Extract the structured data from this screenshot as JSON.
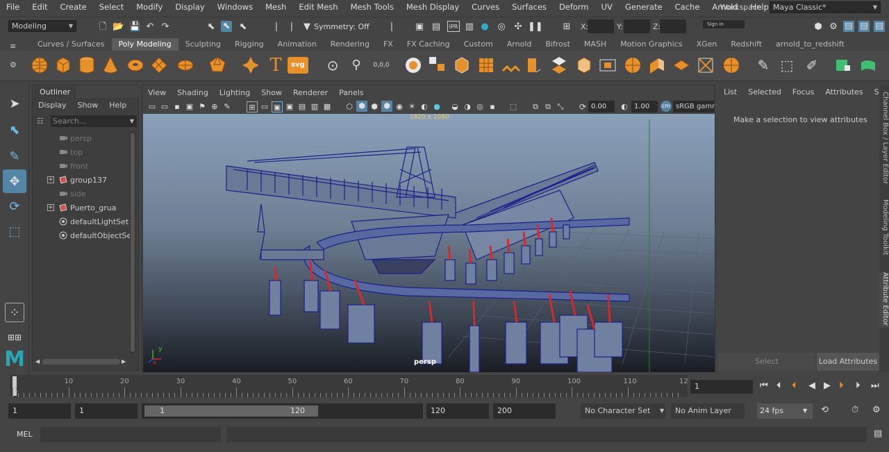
{
  "menubar": {
    "items": [
      "File",
      "Edit",
      "Create",
      "Select",
      "Modify",
      "Display",
      "Windows",
      "Mesh",
      "Edit Mesh",
      "Mesh Tools",
      "Mesh Display",
      "Curves",
      "Surfaces",
      "Deform",
      "UV",
      "Generate",
      "Cache",
      "Arnold",
      "Help"
    ],
    "workspace_label": "Workspace :",
    "workspace_value": "Maya Classic*"
  },
  "statusline": {
    "menuset": "Modeling",
    "symmetry": "Symmetry: Off",
    "x_label": "X:",
    "y_label": "Y:",
    "z_label": "Z:",
    "signin": "Sign in"
  },
  "shelf": {
    "tabs": [
      "Curves / Surfaces",
      "Poly Modeling",
      "Sculpting",
      "Rigging",
      "Animation",
      "Rendering",
      "FX",
      "FX Caching",
      "Custom",
      "Arnold",
      "Bifrost",
      "MASH",
      "Motion Graphics",
      "XGen",
      "Redshift",
      "arnold_to_redshift"
    ],
    "active_tab": 1,
    "text_icon": "T",
    "svg_icon": "svg"
  },
  "outliner": {
    "title": "Outliner",
    "menu": [
      "Display",
      "Show",
      "Help"
    ],
    "search_placeholder": "Search...",
    "items": [
      {
        "label": "persp",
        "type": "camera",
        "dim": true,
        "expandable": false
      },
      {
        "label": "top",
        "type": "camera",
        "dim": true,
        "expandable": false
      },
      {
        "label": "front",
        "type": "camera",
        "dim": true,
        "expandable": false
      },
      {
        "label": "group137",
        "type": "group",
        "dim": false,
        "expandable": true
      },
      {
        "label": "side",
        "type": "camera",
        "dim": true,
        "expandable": false
      },
      {
        "label": "Puerto_grua",
        "type": "group",
        "dim": false,
        "expandable": true
      },
      {
        "label": "defaultLightSet",
        "type": "set",
        "dim": false,
        "expandable": false
      },
      {
        "label": "defaultObjectSet",
        "type": "set",
        "dim": false,
        "expandable": false
      }
    ]
  },
  "viewport": {
    "menu": [
      "View",
      "Shading",
      "Lighting",
      "Show",
      "Renderer",
      "Panels"
    ],
    "resolution": "1920 x 1080",
    "camera_label": "persp",
    "exposure": "0.00",
    "gamma": "1.00",
    "colorspace": "sRGB gamma",
    "axis_y": "y",
    "axis_x": "x"
  },
  "channelbox": {
    "tabs": [
      "List",
      "Selected",
      "Focus",
      "Attributes",
      "Show"
    ],
    "message": "Make a selection to view attributes",
    "select_button": "Select",
    "load_button": "Load Attributes",
    "side_tabs": [
      "Channel Box / Layer Editor",
      "Modeling Toolkit",
      "Attribute Editor"
    ]
  },
  "timeslider": {
    "ticks": [
      "1",
      "10",
      "20",
      "30",
      "40",
      "50",
      "60",
      "70",
      "80",
      "90",
      "100",
      "110",
      "12"
    ],
    "current_frame": "1"
  },
  "rangeslider": {
    "start": "1",
    "playback_start": "1",
    "range_start": "1",
    "range_end": "120",
    "playback_end": "120",
    "end": "200",
    "character_set": "No Character Set",
    "anim_layer": "No Anim Layer",
    "fps": "24 fps"
  },
  "cmdline": {
    "label": "MEL"
  },
  "colors": {
    "accent_blue": "#5285a6",
    "shelf_orange": "#e8902a",
    "maya_logo": "#2aa5b5",
    "wire_blue": "#1a1f8a",
    "wire_red": "#d42a2a"
  }
}
